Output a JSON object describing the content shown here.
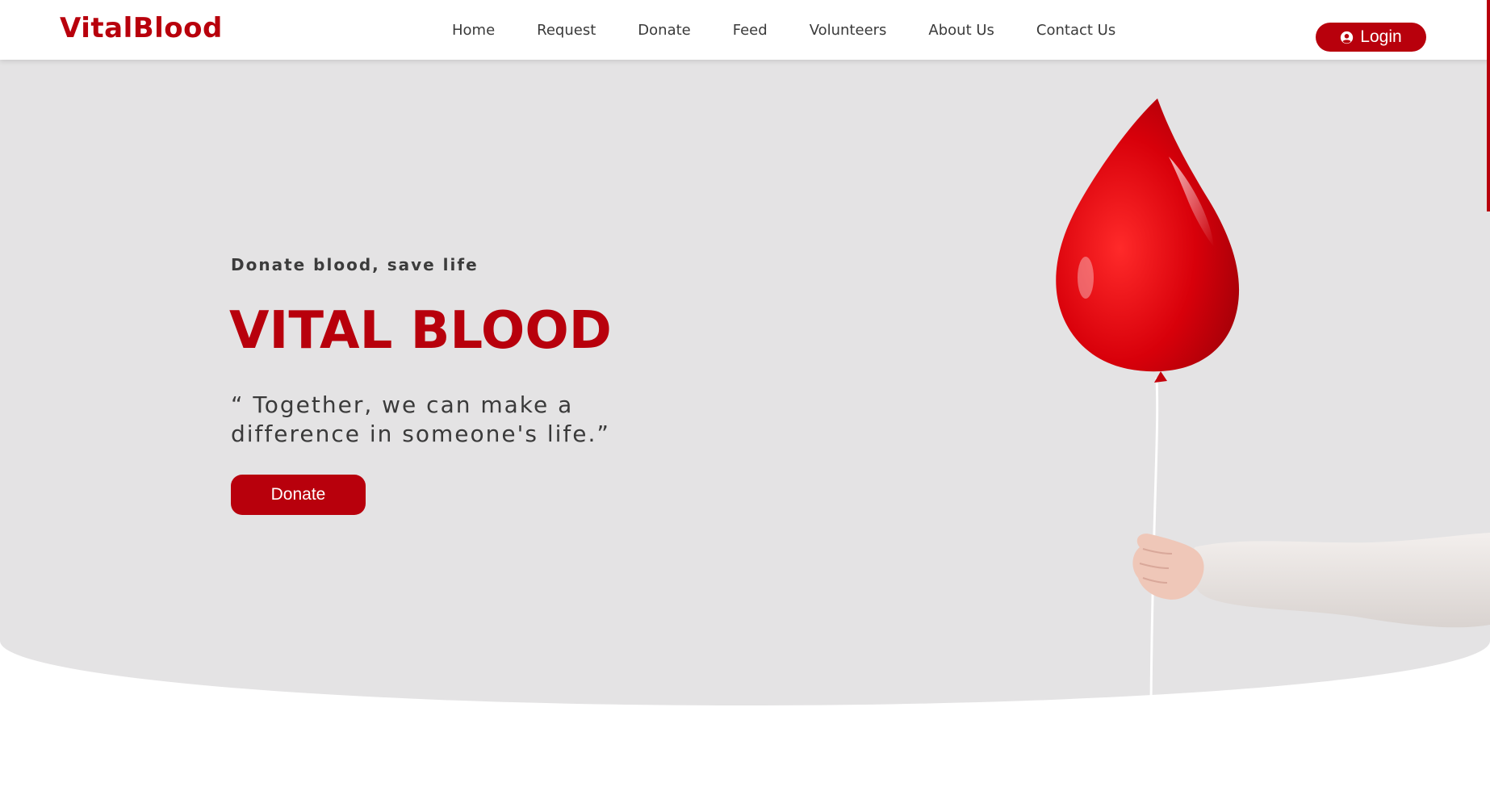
{
  "header": {
    "logo_text": "VitalBlood",
    "nav": [
      "Home",
      "Request",
      "Donate",
      "Feed",
      "Volunteers",
      "About Us",
      "Contact Us"
    ],
    "login_label": "Login"
  },
  "hero": {
    "tagline": "Donate blood, save life",
    "title": "VITAL BLOOD",
    "quote": "“ Together, we can make a difference in someone's life.”",
    "donate_label": "Donate"
  },
  "colors": {
    "brand": "#b8000c",
    "hero_background": "#e4e3e4",
    "text_dark": "#3a3a3a"
  },
  "icons": {
    "login": "user-circle-icon",
    "illustration": "blood-drop-balloon"
  }
}
